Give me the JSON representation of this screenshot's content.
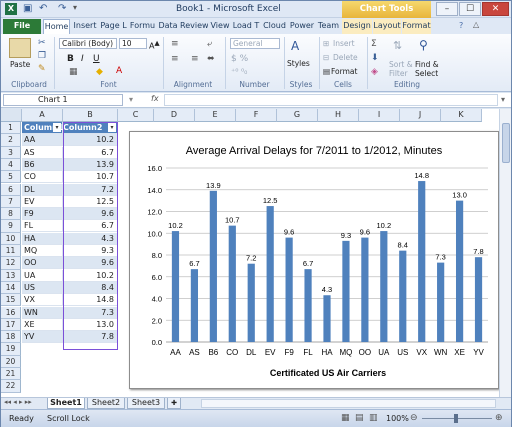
{
  "window": {
    "title": "Book1  -  Microsoft Excel",
    "chart_tools": "Chart Tools",
    "controls": [
      "–",
      "☐",
      "✕"
    ]
  },
  "tabs": {
    "file": "File",
    "items": [
      "Home",
      "Insert",
      "Page L",
      "Formu",
      "Data",
      "Review",
      "View",
      "Load T",
      "Cloud",
      "Power",
      "Team",
      "Design",
      "Layout",
      "Format"
    ]
  },
  "ribbon": {
    "clipboard": {
      "paste": "Paste",
      "label": "Clipboard"
    },
    "font": {
      "name": "Calibri (Body)",
      "size": "10",
      "label": "Font"
    },
    "alignment": {
      "label": "Alignment"
    },
    "number": {
      "format": "General",
      "label": "Number"
    },
    "styles": {
      "label": "Styles"
    },
    "cells": {
      "insert": "Insert",
      "delete": "Delete",
      "format": "Format",
      "label": "Cells"
    },
    "editing": {
      "sort": "Sort &",
      "filter": "Filter",
      "find": "Find &",
      "select": "Select",
      "label": "Editing"
    }
  },
  "formula_bar": {
    "name_box": "Chart 1",
    "fx": "fx",
    "value": ""
  },
  "columns": [
    "A",
    "B",
    "C",
    "D",
    "E",
    "F",
    "G",
    "H",
    "I",
    "J",
    "K"
  ],
  "table": {
    "headers": [
      "Column1",
      "Column2"
    ],
    "rows": [
      [
        "AA",
        "10.2"
      ],
      [
        "AS",
        "6.7"
      ],
      [
        "B6",
        "13.9"
      ],
      [
        "CO",
        "10.7"
      ],
      [
        "DL",
        "7.2"
      ],
      [
        "EV",
        "12.5"
      ],
      [
        "F9",
        "9.6"
      ],
      [
        "FL",
        "6.7"
      ],
      [
        "HA",
        "4.3"
      ],
      [
        "MQ",
        "9.3"
      ],
      [
        "OO",
        "9.6"
      ],
      [
        "UA",
        "10.2"
      ],
      [
        "US",
        "8.4"
      ],
      [
        "VX",
        "14.8"
      ],
      [
        "WN",
        "7.3"
      ],
      [
        "XE",
        "13.0"
      ],
      [
        "YV",
        "7.8"
      ]
    ]
  },
  "row_numbers": [
    "1",
    "2",
    "3",
    "4",
    "5",
    "6",
    "7",
    "8",
    "9",
    "10",
    "11",
    "12",
    "13",
    "14",
    "15",
    "16",
    "17",
    "18",
    "19",
    "20",
    "21",
    "22"
  ],
  "chart_data": {
    "type": "bar",
    "title": "Average Arrival Delays for 7/2011 to 1/2012, Minutes",
    "xlabel": "Certificated US Air Carriers",
    "ylabel": "",
    "categories": [
      "AA",
      "AS",
      "B6",
      "CO",
      "DL",
      "EV",
      "F9",
      "FL",
      "HA",
      "MQ",
      "OO",
      "UA",
      "US",
      "VX",
      "WN",
      "XE",
      "YV"
    ],
    "values": [
      10.2,
      6.7,
      13.9,
      10.7,
      7.2,
      12.5,
      9.6,
      6.7,
      4.3,
      9.3,
      9.6,
      10.2,
      8.4,
      14.8,
      7.3,
      13.0,
      7.8
    ],
    "value_labels": [
      "10.2",
      "6.7",
      "13.9",
      "10.7",
      "7.2",
      "12.5",
      "9.6",
      "6.7",
      "4.3",
      "9.3",
      "9.6",
      "10.2",
      "8.4",
      "14.8",
      "7.3",
      "13.0",
      "7.8"
    ],
    "ylim": [
      0,
      16
    ],
    "yticks": [
      "0.0",
      "2.0",
      "4.0",
      "6.0",
      "8.0",
      "10.0",
      "12.0",
      "14.0",
      "16.0"
    ],
    "grid": true,
    "legend": "none",
    "bar_color": "#4f81bd"
  },
  "sheets": [
    "Sheet1",
    "Sheet2",
    "Sheet3"
  ],
  "status": {
    "ready": "Ready",
    "scroll_lock": "Scroll Lock",
    "zoom": "100%"
  }
}
